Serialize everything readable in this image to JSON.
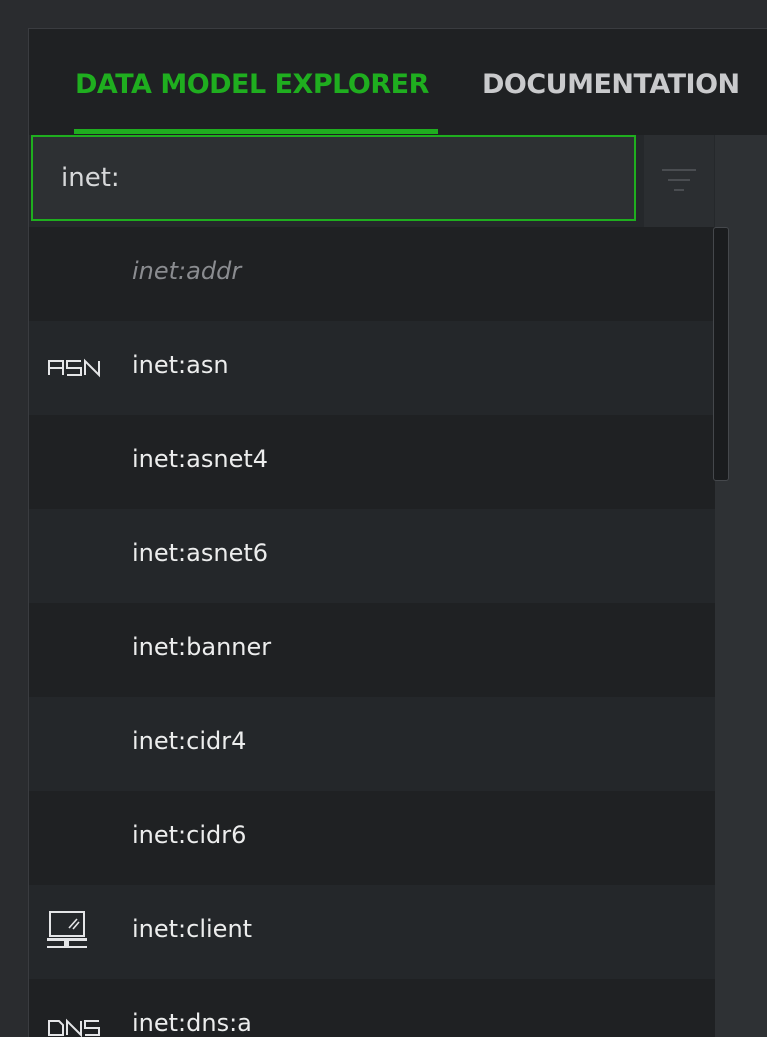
{
  "tabs": [
    {
      "label": "DATA MODEL EXPLORER",
      "active": true
    },
    {
      "label": "DOCUMENTATION",
      "active": false
    }
  ],
  "search": {
    "value": "inet:",
    "placeholder": ""
  },
  "filter_icon": "filter-icon",
  "list": [
    {
      "label": "inet:addr",
      "icon": "",
      "italic": true
    },
    {
      "label": "inet:asn",
      "icon": "asn-icon",
      "icon_text": "ASN",
      "italic": false
    },
    {
      "label": "inet:asnet4",
      "icon": "",
      "italic": false
    },
    {
      "label": "inet:asnet6",
      "icon": "",
      "italic": false
    },
    {
      "label": "inet:banner",
      "icon": "",
      "italic": false
    },
    {
      "label": "inet:cidr4",
      "icon": "",
      "italic": false
    },
    {
      "label": "inet:cidr6",
      "icon": "",
      "italic": false
    },
    {
      "label": "inet:client",
      "icon": "computer-network-icon",
      "italic": false
    },
    {
      "label": "inet:dns:a",
      "icon": "dns-icon",
      "icon_text": "DNS",
      "italic": false
    }
  ],
  "colors": {
    "accent": "#1fae1f",
    "background": "#1f2123",
    "row_alt": "#24272a"
  }
}
